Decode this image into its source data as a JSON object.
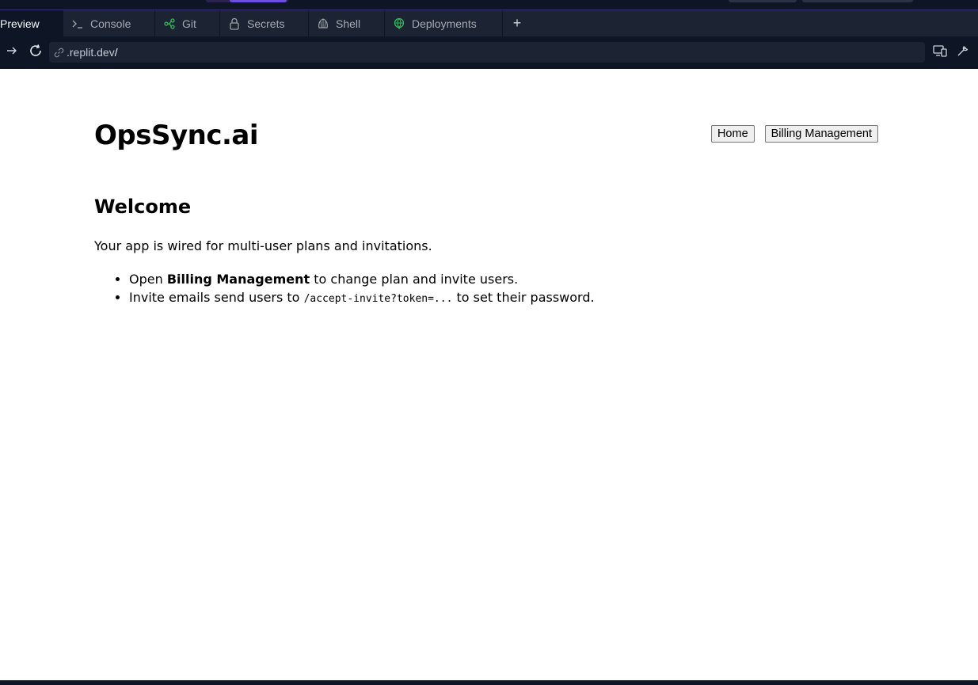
{
  "ide": {
    "tabs": [
      {
        "label": "Preview",
        "icon": "preview-icon"
      },
      {
        "label": "Console",
        "icon": "terminal-icon"
      },
      {
        "label": "Git",
        "icon": "git-icon"
      },
      {
        "label": "Secrets",
        "icon": "lock-icon"
      },
      {
        "label": "Shell",
        "icon": "shell-icon"
      },
      {
        "label": "Deployments",
        "icon": "globe-icon"
      }
    ],
    "add_tab_label": "+",
    "url_host": ".replit.dev",
    "url_path": "/",
    "colors": {
      "ide_bg": "#0e1525",
      "tab_bg": "#1c2333",
      "accent": "#6b4fe0"
    }
  },
  "app": {
    "title": "OpsSync.ai",
    "nav": {
      "home": "Home",
      "billing": "Billing Management"
    },
    "heading": "Welcome",
    "intro": "Your app is wired for multi-user plans and invitations.",
    "bullet1": {
      "pre": "Open ",
      "bold": "Billing Management",
      "post": " to change plan and invite users."
    },
    "bullet2": {
      "pre": "Invite emails send users to ",
      "code": "/accept-invite?token=...",
      "post": " to set their password."
    }
  }
}
